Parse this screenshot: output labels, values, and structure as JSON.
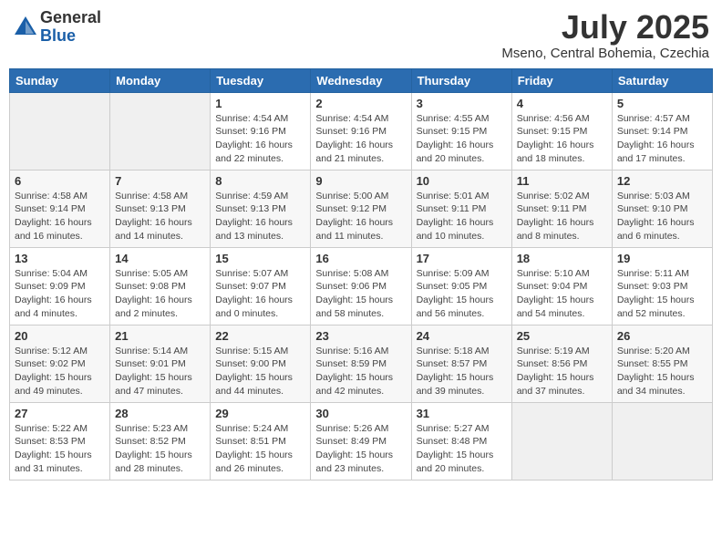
{
  "header": {
    "logo_general": "General",
    "logo_blue": "Blue",
    "month_year": "July 2025",
    "location": "Mseno, Central Bohemia, Czechia"
  },
  "days_of_week": [
    "Sunday",
    "Monday",
    "Tuesday",
    "Wednesday",
    "Thursday",
    "Friday",
    "Saturday"
  ],
  "weeks": [
    [
      {
        "num": "",
        "sunrise": "",
        "sunset": "",
        "daylight": "",
        "empty": true
      },
      {
        "num": "",
        "sunrise": "",
        "sunset": "",
        "daylight": "",
        "empty": true
      },
      {
        "num": "1",
        "sunrise": "Sunrise: 4:54 AM",
        "sunset": "Sunset: 9:16 PM",
        "daylight": "Daylight: 16 hours and 22 minutes.",
        "empty": false
      },
      {
        "num": "2",
        "sunrise": "Sunrise: 4:54 AM",
        "sunset": "Sunset: 9:16 PM",
        "daylight": "Daylight: 16 hours and 21 minutes.",
        "empty": false
      },
      {
        "num": "3",
        "sunrise": "Sunrise: 4:55 AM",
        "sunset": "Sunset: 9:15 PM",
        "daylight": "Daylight: 16 hours and 20 minutes.",
        "empty": false
      },
      {
        "num": "4",
        "sunrise": "Sunrise: 4:56 AM",
        "sunset": "Sunset: 9:15 PM",
        "daylight": "Daylight: 16 hours and 18 minutes.",
        "empty": false
      },
      {
        "num": "5",
        "sunrise": "Sunrise: 4:57 AM",
        "sunset": "Sunset: 9:14 PM",
        "daylight": "Daylight: 16 hours and 17 minutes.",
        "empty": false
      }
    ],
    [
      {
        "num": "6",
        "sunrise": "Sunrise: 4:58 AM",
        "sunset": "Sunset: 9:14 PM",
        "daylight": "Daylight: 16 hours and 16 minutes.",
        "empty": false
      },
      {
        "num": "7",
        "sunrise": "Sunrise: 4:58 AM",
        "sunset": "Sunset: 9:13 PM",
        "daylight": "Daylight: 16 hours and 14 minutes.",
        "empty": false
      },
      {
        "num": "8",
        "sunrise": "Sunrise: 4:59 AM",
        "sunset": "Sunset: 9:13 PM",
        "daylight": "Daylight: 16 hours and 13 minutes.",
        "empty": false
      },
      {
        "num": "9",
        "sunrise": "Sunrise: 5:00 AM",
        "sunset": "Sunset: 9:12 PM",
        "daylight": "Daylight: 16 hours and 11 minutes.",
        "empty": false
      },
      {
        "num": "10",
        "sunrise": "Sunrise: 5:01 AM",
        "sunset": "Sunset: 9:11 PM",
        "daylight": "Daylight: 16 hours and 10 minutes.",
        "empty": false
      },
      {
        "num": "11",
        "sunrise": "Sunrise: 5:02 AM",
        "sunset": "Sunset: 9:11 PM",
        "daylight": "Daylight: 16 hours and 8 minutes.",
        "empty": false
      },
      {
        "num": "12",
        "sunrise": "Sunrise: 5:03 AM",
        "sunset": "Sunset: 9:10 PM",
        "daylight": "Daylight: 16 hours and 6 minutes.",
        "empty": false
      }
    ],
    [
      {
        "num": "13",
        "sunrise": "Sunrise: 5:04 AM",
        "sunset": "Sunset: 9:09 PM",
        "daylight": "Daylight: 16 hours and 4 minutes.",
        "empty": false
      },
      {
        "num": "14",
        "sunrise": "Sunrise: 5:05 AM",
        "sunset": "Sunset: 9:08 PM",
        "daylight": "Daylight: 16 hours and 2 minutes.",
        "empty": false
      },
      {
        "num": "15",
        "sunrise": "Sunrise: 5:07 AM",
        "sunset": "Sunset: 9:07 PM",
        "daylight": "Daylight: 16 hours and 0 minutes.",
        "empty": false
      },
      {
        "num": "16",
        "sunrise": "Sunrise: 5:08 AM",
        "sunset": "Sunset: 9:06 PM",
        "daylight": "Daylight: 15 hours and 58 minutes.",
        "empty": false
      },
      {
        "num": "17",
        "sunrise": "Sunrise: 5:09 AM",
        "sunset": "Sunset: 9:05 PM",
        "daylight": "Daylight: 15 hours and 56 minutes.",
        "empty": false
      },
      {
        "num": "18",
        "sunrise": "Sunrise: 5:10 AM",
        "sunset": "Sunset: 9:04 PM",
        "daylight": "Daylight: 15 hours and 54 minutes.",
        "empty": false
      },
      {
        "num": "19",
        "sunrise": "Sunrise: 5:11 AM",
        "sunset": "Sunset: 9:03 PM",
        "daylight": "Daylight: 15 hours and 52 minutes.",
        "empty": false
      }
    ],
    [
      {
        "num": "20",
        "sunrise": "Sunrise: 5:12 AM",
        "sunset": "Sunset: 9:02 PM",
        "daylight": "Daylight: 15 hours and 49 minutes.",
        "empty": false
      },
      {
        "num": "21",
        "sunrise": "Sunrise: 5:14 AM",
        "sunset": "Sunset: 9:01 PM",
        "daylight": "Daylight: 15 hours and 47 minutes.",
        "empty": false
      },
      {
        "num": "22",
        "sunrise": "Sunrise: 5:15 AM",
        "sunset": "Sunset: 9:00 PM",
        "daylight": "Daylight: 15 hours and 44 minutes.",
        "empty": false
      },
      {
        "num": "23",
        "sunrise": "Sunrise: 5:16 AM",
        "sunset": "Sunset: 8:59 PM",
        "daylight": "Daylight: 15 hours and 42 minutes.",
        "empty": false
      },
      {
        "num": "24",
        "sunrise": "Sunrise: 5:18 AM",
        "sunset": "Sunset: 8:57 PM",
        "daylight": "Daylight: 15 hours and 39 minutes.",
        "empty": false
      },
      {
        "num": "25",
        "sunrise": "Sunrise: 5:19 AM",
        "sunset": "Sunset: 8:56 PM",
        "daylight": "Daylight: 15 hours and 37 minutes.",
        "empty": false
      },
      {
        "num": "26",
        "sunrise": "Sunrise: 5:20 AM",
        "sunset": "Sunset: 8:55 PM",
        "daylight": "Daylight: 15 hours and 34 minutes.",
        "empty": false
      }
    ],
    [
      {
        "num": "27",
        "sunrise": "Sunrise: 5:22 AM",
        "sunset": "Sunset: 8:53 PM",
        "daylight": "Daylight: 15 hours and 31 minutes.",
        "empty": false
      },
      {
        "num": "28",
        "sunrise": "Sunrise: 5:23 AM",
        "sunset": "Sunset: 8:52 PM",
        "daylight": "Daylight: 15 hours and 28 minutes.",
        "empty": false
      },
      {
        "num": "29",
        "sunrise": "Sunrise: 5:24 AM",
        "sunset": "Sunset: 8:51 PM",
        "daylight": "Daylight: 15 hours and 26 minutes.",
        "empty": false
      },
      {
        "num": "30",
        "sunrise": "Sunrise: 5:26 AM",
        "sunset": "Sunset: 8:49 PM",
        "daylight": "Daylight: 15 hours and 23 minutes.",
        "empty": false
      },
      {
        "num": "31",
        "sunrise": "Sunrise: 5:27 AM",
        "sunset": "Sunset: 8:48 PM",
        "daylight": "Daylight: 15 hours and 20 minutes.",
        "empty": false
      },
      {
        "num": "",
        "sunrise": "",
        "sunset": "",
        "daylight": "",
        "empty": true
      },
      {
        "num": "",
        "sunrise": "",
        "sunset": "",
        "daylight": "",
        "empty": true
      }
    ]
  ]
}
